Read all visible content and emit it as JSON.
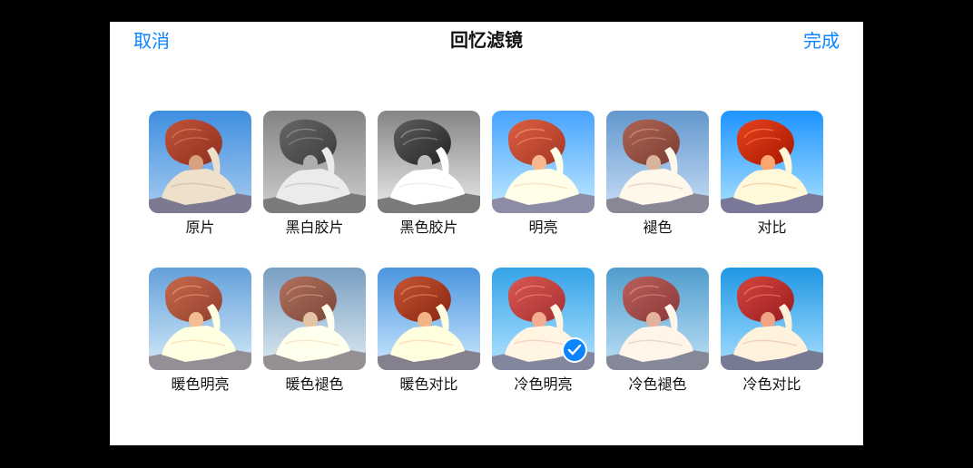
{
  "nav": {
    "cancel_label": "取消",
    "title": "回忆滤镜",
    "done_label": "完成"
  },
  "accent_color": "#0a84ff",
  "selected_filter": "冷色明亮",
  "filters": [
    {
      "label": "原片"
    },
    {
      "label": "黑白胶片"
    },
    {
      "label": "黑色胶片"
    },
    {
      "label": "明亮"
    },
    {
      "label": "褪色"
    },
    {
      "label": "对比"
    },
    {
      "label": "暖色明亮"
    },
    {
      "label": "暖色褪色"
    },
    {
      "label": "暖色对比"
    },
    {
      "label": "冷色明亮"
    },
    {
      "label": "冷色褪色"
    },
    {
      "label": "冷色对比"
    }
  ]
}
